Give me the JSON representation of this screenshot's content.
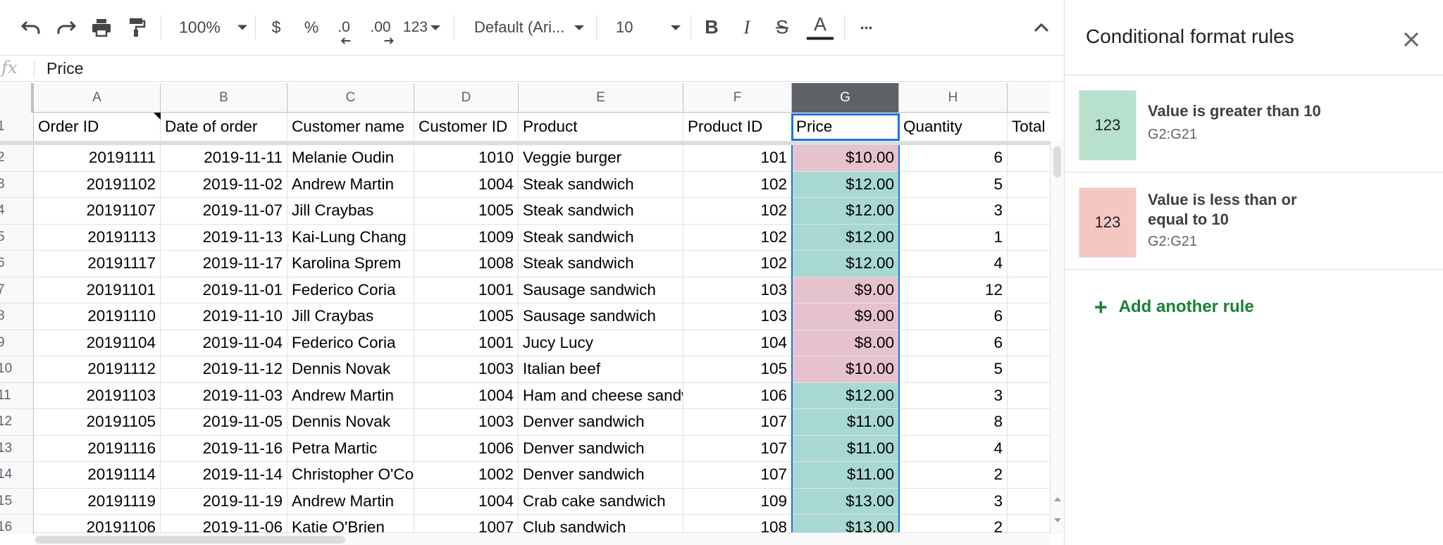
{
  "toolbar": {
    "zoom": "100%",
    "currency": "$",
    "percent": "%",
    "decrease_decimal": ".0",
    "increase_decimal": ".00",
    "number_format": "123",
    "font_family": "Default (Ari...",
    "font_size": "10",
    "bold": "B",
    "italic": "I",
    "strikethrough": "S",
    "text_color": "A",
    "more": "•••"
  },
  "formula_bar": {
    "fx": "fx",
    "value": "Price"
  },
  "columns": [
    "A",
    "B",
    "C",
    "D",
    "E",
    "F",
    "G",
    "H",
    ""
  ],
  "headers": [
    "Order ID",
    "Date of order",
    "Customer name",
    "Customer ID",
    "Product",
    "Product ID",
    "Price",
    "Quantity",
    "Total"
  ],
  "rows": [
    {
      "n": "2",
      "cells": [
        "20191111",
        "2019-11-11",
        "Melanie Oudin",
        "1010",
        "Veggie burger",
        "101",
        "$10.00",
        "6"
      ],
      "rule": "low"
    },
    {
      "n": "3",
      "cells": [
        "20191102",
        "2019-11-02",
        "Andrew Martin",
        "1004",
        "Steak sandwich",
        "102",
        "$12.00",
        "5"
      ],
      "rule": "high"
    },
    {
      "n": "4",
      "cells": [
        "20191107",
        "2019-11-07",
        "Jill Craybas",
        "1005",
        "Steak sandwich",
        "102",
        "$12.00",
        "3"
      ],
      "rule": "high"
    },
    {
      "n": "5",
      "cells": [
        "20191113",
        "2019-11-13",
        "Kai-Lung Chang",
        "1009",
        "Steak sandwich",
        "102",
        "$12.00",
        "1"
      ],
      "rule": "high"
    },
    {
      "n": "6",
      "cells": [
        "20191117",
        "2019-11-17",
        "Karolina Sprem",
        "1008",
        "Steak sandwich",
        "102",
        "$12.00",
        "4"
      ],
      "rule": "high"
    },
    {
      "n": "7",
      "cells": [
        "20191101",
        "2019-11-01",
        "Federico Coria",
        "1001",
        "Sausage sandwich",
        "103",
        "$9.00",
        "12"
      ],
      "rule": "low"
    },
    {
      "n": "8",
      "cells": [
        "20191110",
        "2019-11-10",
        "Jill Craybas",
        "1005",
        "Sausage sandwich",
        "103",
        "$9.00",
        "6"
      ],
      "rule": "low"
    },
    {
      "n": "9",
      "cells": [
        "20191104",
        "2019-11-04",
        "Federico Coria",
        "1001",
        "Jucy Lucy",
        "104",
        "$8.00",
        "6"
      ],
      "rule": "low"
    },
    {
      "n": "10",
      "cells": [
        "20191112",
        "2019-11-12",
        "Dennis Novak",
        "1003",
        "Italian beef",
        "105",
        "$10.00",
        "5"
      ],
      "rule": "low"
    },
    {
      "n": "11",
      "cells": [
        "20191103",
        "2019-11-03",
        "Andrew Martin",
        "1004",
        "Ham and cheese sandwich",
        "106",
        "$12.00",
        "3"
      ],
      "rule": "high"
    },
    {
      "n": "12",
      "cells": [
        "20191105",
        "2019-11-05",
        "Dennis Novak",
        "1003",
        "Denver sandwich",
        "107",
        "$11.00",
        "8"
      ],
      "rule": "high"
    },
    {
      "n": "13",
      "cells": [
        "20191116",
        "2019-11-16",
        "Petra Martic",
        "1006",
        "Denver sandwich",
        "107",
        "$11.00",
        "4"
      ],
      "rule": "high"
    },
    {
      "n": "14",
      "cells": [
        "20191114",
        "2019-11-14",
        "Christopher O'Connell",
        "1002",
        "Denver sandwich",
        "107",
        "$11.00",
        "2"
      ],
      "rule": "high"
    },
    {
      "n": "15",
      "cells": [
        "20191119",
        "2019-11-19",
        "Andrew Martin",
        "1004",
        "Crab cake sandwich",
        "109",
        "$13.00",
        "3"
      ],
      "rule": "high"
    },
    {
      "n": "16",
      "cells": [
        "20191106",
        "2019-11-06",
        "Katie O'Brien",
        "1007",
        "Club sandwich",
        "108",
        "$13.00",
        "2"
      ],
      "rule": "high"
    }
  ],
  "panel": {
    "title": "Conditional format rules",
    "rules": [
      {
        "swatch": "123",
        "title": "Value is greater than 10",
        "range": "G2:G21",
        "color": "#b7e1cd"
      },
      {
        "swatch": "123",
        "title": "Value is less than or equal to 10",
        "range": "G2:G21",
        "color": "#f4c7c3"
      }
    ],
    "add_rule": "Add another rule"
  },
  "colors": {
    "high_fill": "#a8d8d2",
    "low_fill": "#e6c3cc",
    "selection": "#1a73e8",
    "accent_green": "#188038"
  }
}
